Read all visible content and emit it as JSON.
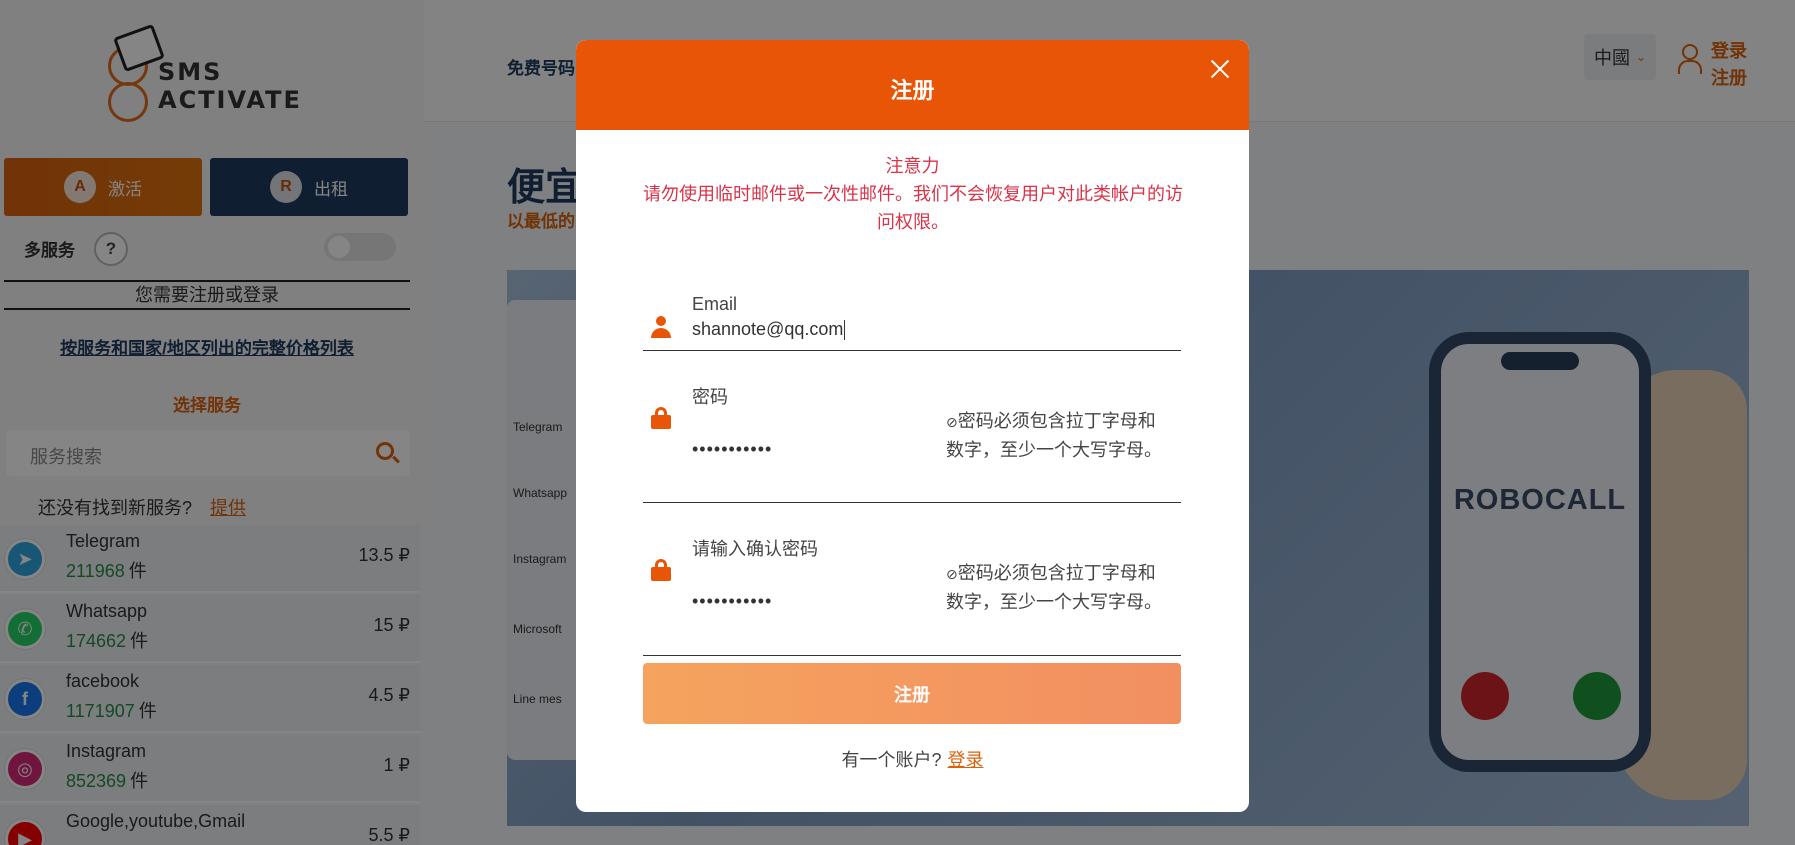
{
  "logo": {
    "line1": "SMS",
    "line2": "ACTIVATE"
  },
  "sidebar": {
    "tab_activate": "激活",
    "tab_rent": "出租",
    "multi_service": "多服务",
    "help": "?",
    "need_login": "您需要注册或登录",
    "price_list_link": "按服务和国家/地区列出的完整价格列表",
    "choose_service": "选择服务",
    "search_placeholder": "服务搜索",
    "not_found": "还没有找到新服务?",
    "offer_link": "提供",
    "services": [
      {
        "name": "Telegram",
        "count": "211968",
        "unit": "件",
        "price": "13.5 ₽",
        "icon": "telegram-icon",
        "color": "#2ca5e0"
      },
      {
        "name": "Whatsapp",
        "count": "174662",
        "unit": "件",
        "price": "15 ₽",
        "icon": "whatsapp-icon",
        "color": "#25d366"
      },
      {
        "name": "facebook",
        "count": "1171907",
        "unit": "件",
        "price": "4.5 ₽",
        "icon": "facebook-icon",
        "color": "#1877f2"
      },
      {
        "name": "Instagram",
        "count": "852369",
        "unit": "件",
        "price": "1 ₽",
        "icon": "instagram-icon",
        "color": "#d62976"
      },
      {
        "name": "Google,youtube,Gmail",
        "count": "",
        "unit": "",
        "price": "5.5 ₽",
        "icon": "youtube-icon",
        "color": "#ff0000"
      }
    ]
  },
  "header": {
    "nav_free": "免费号码",
    "lang": "中國",
    "login": "登录",
    "register": "注册"
  },
  "hero": {
    "title": "便宜",
    "subtitle": "以最低的",
    "image_text": "ROBOCALL",
    "card_rows": [
      "Telegram",
      "Whatsapp",
      "Instagram",
      "Microsoft",
      "Line mes"
    ]
  },
  "modal": {
    "title": "注册",
    "warning_title": "注意力",
    "warning_text": "请勿使用临时邮件或一次性邮件。我们不会恢复用户对此类帐户的访问权限。",
    "email_label": "Email",
    "email_value": "shannote@qq.com",
    "password_label": "密码",
    "password_value": "•••••••••••",
    "password_hint": "密码必须包含拉丁字母和数字，至少一个大写字母。",
    "confirm_label": "请输入确认密码",
    "confirm_value": "•••••••••••",
    "confirm_hint": "密码必须包含拉丁字母和数字，至少一个大写字母。",
    "submit": "注册",
    "have_account": "有一个账户?",
    "login_link": "登录"
  }
}
